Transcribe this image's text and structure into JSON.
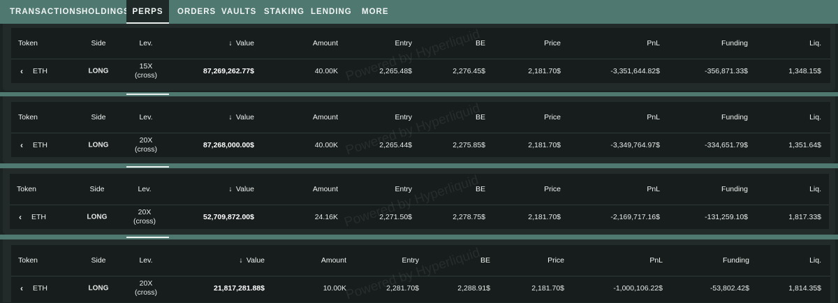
{
  "tabs": [
    {
      "label": "TRANSACTIONS",
      "active": false
    },
    {
      "label": "HOLDINGS",
      "active": false
    },
    {
      "label": "PERPS",
      "active": true
    },
    {
      "label": "ORDERS",
      "active": false
    },
    {
      "label": "VAULTS",
      "active": false
    },
    {
      "label": "STAKING",
      "active": false
    },
    {
      "label": "LENDING",
      "active": false
    },
    {
      "label": "MORE",
      "active": false
    }
  ],
  "colors": {
    "band": "#4e7870",
    "long": "#2fc25f",
    "negative": "#ee3b3b",
    "panel": "#222b29",
    "table": "#161d1c"
  },
  "watermark": "Powered by Hyperliquid",
  "columns": {
    "token": "Token",
    "side": "Side",
    "lev": "Lev.",
    "sort_icon": "↓",
    "value": "Value",
    "amount": "Amount",
    "entry": "Entry",
    "be": "BE",
    "price": "Price",
    "pnl": "PnL",
    "funding": "Funding",
    "liq": "Liq."
  },
  "positions": [
    {
      "token": "ETH",
      "side": "LONG",
      "lev": "15X",
      "mode": "(cross)",
      "value": "87,269,262.77$",
      "amount": "40.00K",
      "entry": "2,265.48$",
      "be": "2,276.45$",
      "price": "2,181.70$",
      "pnl": "-3,351,644.82$",
      "funding": "-356,871.33$",
      "liq": "1,348.15$"
    },
    {
      "token": "ETH",
      "side": "LONG",
      "lev": "20X",
      "mode": "(cross)",
      "value": "87,268,000.00$",
      "amount": "40.00K",
      "entry": "2,265.44$",
      "be": "2,275.85$",
      "price": "2,181.70$",
      "pnl": "-3,349,764.97$",
      "funding": "-334,651.79$",
      "liq": "1,351.64$"
    },
    {
      "token": "ETH",
      "side": "LONG",
      "lev": "20X",
      "mode": "(cross)",
      "value": "52,709,872.00$",
      "amount": "24.16K",
      "entry": "2,271.50$",
      "be": "2,278.75$",
      "price": "2,181.70$",
      "pnl": "-2,169,717.16$",
      "funding": "-131,259.10$",
      "liq": "1,817.33$"
    },
    {
      "token": "ETH",
      "side": "LONG",
      "lev": "20X",
      "mode": "(cross)",
      "value": "21,817,281.88$",
      "amount": "10.00K",
      "entry": "2,281.70$",
      "be": "2,288.91$",
      "price": "2,181.70$",
      "pnl": "-1,000,106.22$",
      "funding": "-53,802.42$",
      "liq": "1,814.35$"
    }
  ]
}
